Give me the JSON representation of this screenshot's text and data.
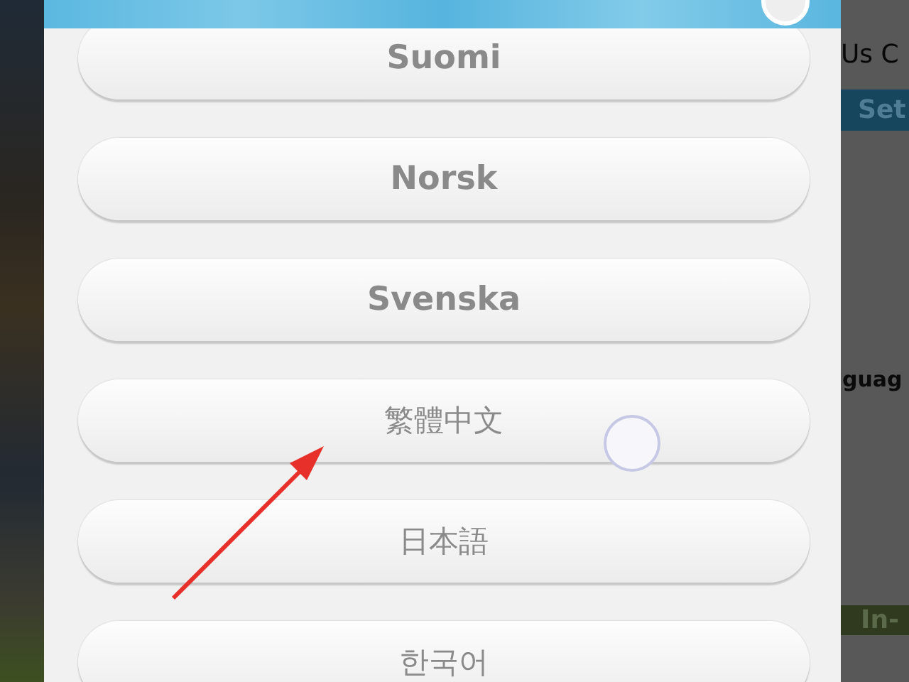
{
  "background": {
    "texts": [
      "Us C",
      "Set",
      "guag",
      "In-"
    ]
  },
  "languages": [
    {
      "label": "Suomi",
      "bold": true
    },
    {
      "label": "Norsk",
      "bold": true
    },
    {
      "label": "Svenska",
      "bold": true
    },
    {
      "label": "繁體中文",
      "bold": false
    },
    {
      "label": "日本語",
      "bold": false
    },
    {
      "label": "한국어",
      "bold": false
    }
  ]
}
